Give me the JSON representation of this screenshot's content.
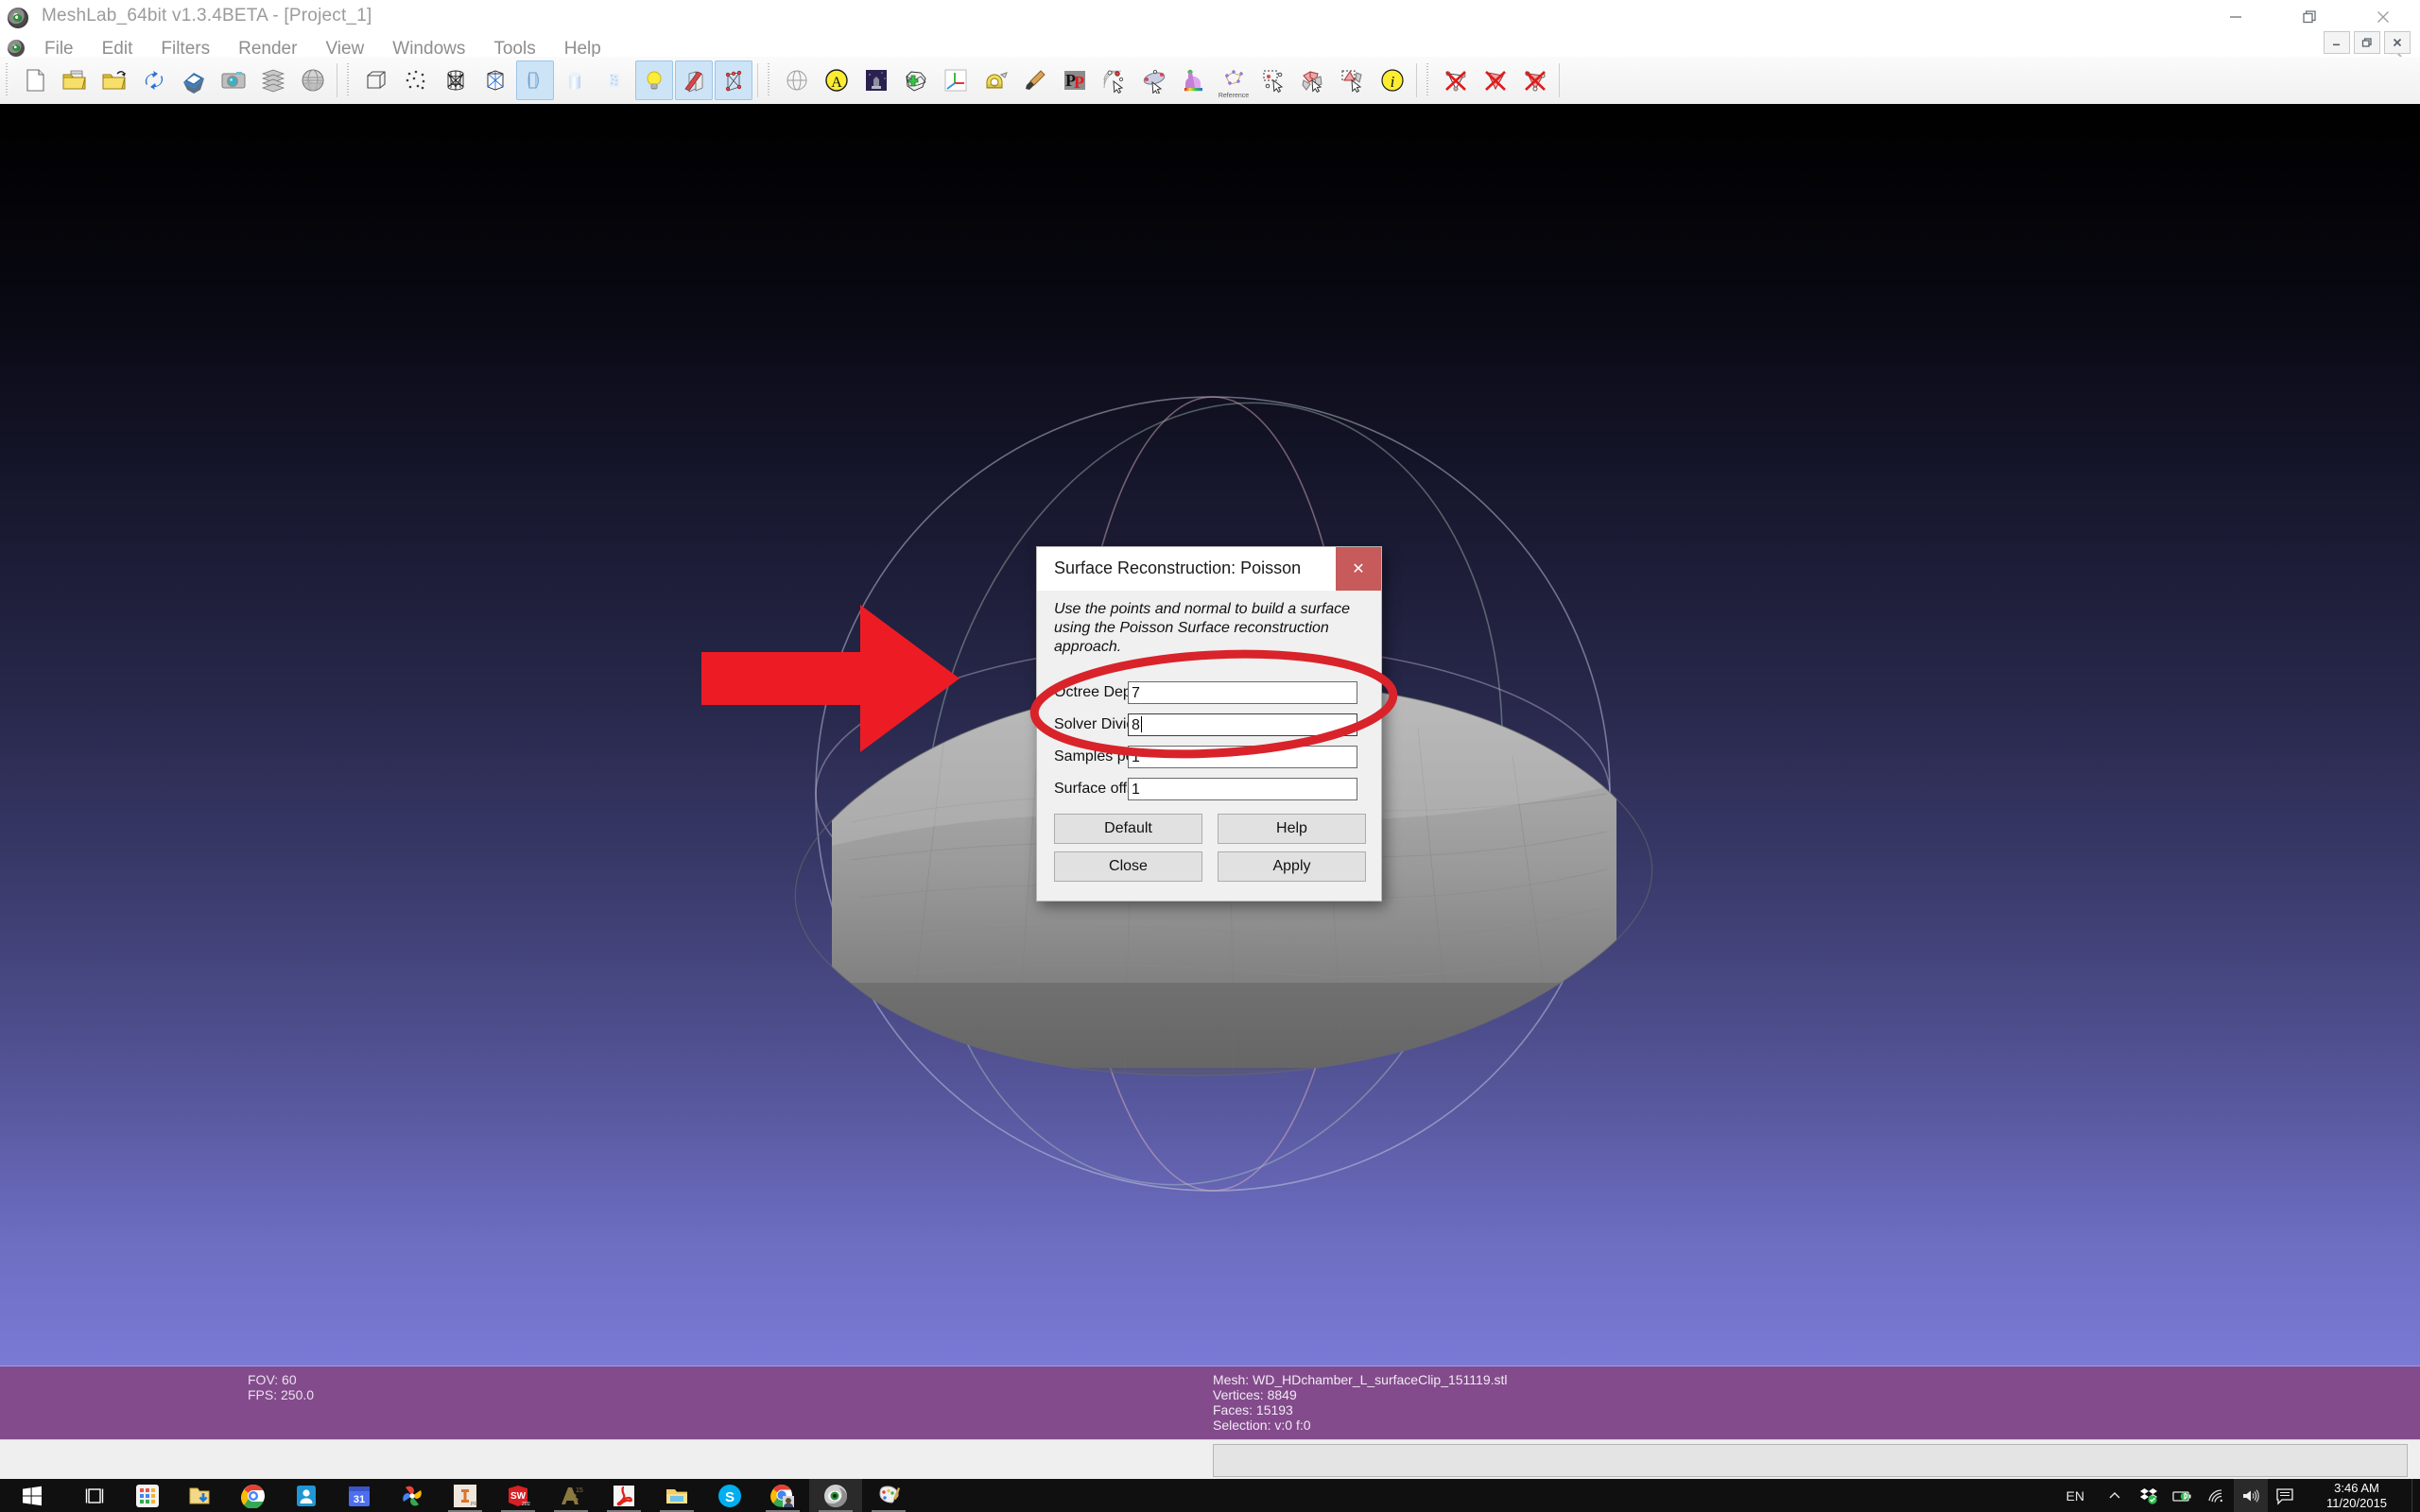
{
  "window": {
    "title": "MeshLab_64bit v1.3.4BETA - [Project_1]",
    "app_icon": "meshlab-eye-icon",
    "controls": [
      {
        "name": "minimize-button",
        "glyph": "minimize-icon"
      },
      {
        "name": "restore-button",
        "glyph": "restore-icon"
      },
      {
        "name": "close-button",
        "glyph": "close-icon"
      }
    ],
    "mdi_controls": [
      {
        "name": "mdi-minimize-button",
        "glyph": "minimize-icon"
      },
      {
        "name": "mdi-restore-button",
        "glyph": "restore-icon"
      },
      {
        "name": "mdi-close-button",
        "glyph": "close-icon"
      }
    ]
  },
  "menubar": {
    "items": [
      {
        "label": "File"
      },
      {
        "label": "Edit"
      },
      {
        "label": "Filters"
      },
      {
        "label": "Render"
      },
      {
        "label": "View"
      },
      {
        "label": "Windows"
      },
      {
        "label": "Tools"
      },
      {
        "label": "Help"
      }
    ],
    "search_icon": "search-icon"
  },
  "toolbar": {
    "groups": [
      {
        "buttons": [
          {
            "name": "new-project-button",
            "icon": "new-document-icon",
            "state": "off"
          },
          {
            "name": "open-project-button",
            "icon": "open-project-folder-icon",
            "state": "off"
          },
          {
            "name": "import-mesh-button",
            "icon": "open-folder-icon",
            "state": "off"
          },
          {
            "name": "reload-button",
            "icon": "reload-arrows-icon",
            "state": "off"
          },
          {
            "name": "save-snapshot-button",
            "icon": "save-layer-icon",
            "state": "off"
          },
          {
            "name": "take-snapshot-button",
            "icon": "camera-icon",
            "state": "off"
          },
          {
            "name": "show-layer-dialog-button",
            "icon": "layers-stack-icon",
            "state": "off"
          },
          {
            "name": "raster-layers-button",
            "icon": "globe-raster-icon",
            "state": "off"
          }
        ]
      },
      {
        "buttons": [
          {
            "name": "bounding-box-button",
            "icon": "wire-cube-icon",
            "state": "off"
          },
          {
            "name": "points-render-button",
            "icon": "point-cloud-icon",
            "state": "off"
          },
          {
            "name": "wireframe-render-button",
            "icon": "wireframe-icon",
            "state": "off"
          },
          {
            "name": "hidden-lines-render-button",
            "icon": "hidden-lines-icon",
            "state": "off"
          },
          {
            "name": "flat-lines-render-button",
            "icon": "flat-lines-icon",
            "state": "on"
          },
          {
            "name": "flat-render-button",
            "icon": "flat-shading-icon",
            "state": "off"
          },
          {
            "name": "smooth-render-button",
            "icon": "smooth-shading-icon",
            "state": "off"
          },
          {
            "name": "lighting-toggle-button",
            "icon": "lightbulb-icon",
            "state": "on"
          },
          {
            "name": "double-side-lighting-button",
            "icon": "double-side-light-icon",
            "state": "on"
          },
          {
            "name": "show-vertex-quality-button",
            "icon": "vertex-dots-icon",
            "state": "on"
          }
        ]
      },
      {
        "buttons": [
          {
            "name": "trackball-toggle-button",
            "icon": "trackball-sphere-icon",
            "state": "off"
          },
          {
            "name": "show-axis-button",
            "icon": "yellow-a-icon",
            "state": "off"
          },
          {
            "name": "shadow-mapping-button",
            "icon": "shadow-render-icon",
            "state": "off"
          },
          {
            "name": "select-faces-button",
            "icon": "green-mesh-icon",
            "state": "off"
          },
          {
            "name": "show-axes-button",
            "icon": "rgb-axes-icon",
            "state": "off"
          },
          {
            "name": "measuring-tool-button",
            "icon": "measuring-tape-icon",
            "state": "off"
          },
          {
            "name": "paint-tool-button",
            "icon": "paintbrush-icon",
            "state": "off"
          },
          {
            "name": "pickpoints-button",
            "icon": "pp-letters-icon",
            "state": "off"
          },
          {
            "name": "get-point-info-button",
            "icon": "pick-point-icon",
            "state": "off"
          },
          {
            "name": "edit-align-button",
            "icon": "align-points-icon",
            "state": "off"
          },
          {
            "name": "quality-mapper-button",
            "icon": "colored-bunny-icon",
            "state": "off"
          },
          {
            "name": "reference-button",
            "icon": "reference-graph-icon",
            "state": "off",
            "caption": "Reference"
          },
          {
            "name": "select-vertices-button",
            "icon": "rubber-band-select-icon",
            "state": "off"
          },
          {
            "name": "select-faces-click-button",
            "icon": "select-faces-icon",
            "state": "off"
          },
          {
            "name": "select-connected-button",
            "icon": "select-connected-icon",
            "state": "off"
          },
          {
            "name": "mesh-info-button",
            "icon": "info-icon",
            "state": "off"
          }
        ]
      },
      {
        "buttons": [
          {
            "name": "delete-vertices-button",
            "icon": "delete-vertices-icon",
            "state": "off"
          },
          {
            "name": "delete-faces-button",
            "icon": "delete-faces-icon",
            "state": "off"
          },
          {
            "name": "delete-faces-vertices-button",
            "icon": "delete-faces-vertices-icon",
            "state": "off"
          }
        ]
      }
    ]
  },
  "dialog": {
    "title": "Surface Reconstruction: Poisson",
    "close_label": "✕",
    "description": "Use the points and normal to build a surface using the Poisson Surface reconstruction approach.",
    "fields": [
      {
        "label": "Octree Depth",
        "value": "7",
        "focused": false
      },
      {
        "label": "Solver Divide",
        "value": "8",
        "focused": true
      },
      {
        "label": "Samples per Node",
        "value": "1",
        "focused": false
      },
      {
        "label": "Surface offsetting",
        "value": "1",
        "focused": false
      }
    ],
    "buttons": {
      "default": "Default",
      "help": "Help",
      "close": "Close",
      "apply": "Apply"
    }
  },
  "statusbar": {
    "left": [
      "FOV: 60",
      "FPS:  250.0"
    ],
    "mesh": [
      "Mesh: WD_HDchamber_L_surfaceClip_151119.stl",
      "Vertices: 8849",
      "Faces: 15193",
      "Selection: v:0 f:0"
    ]
  },
  "annotation": {
    "arrow": "red-arrow-annotation",
    "ellipse": "red-ellipse-annotation",
    "color": "#ED1C24",
    "ellipse_color": "#D9232A"
  },
  "taskbar": {
    "start": "windows-start-icon",
    "items": [
      {
        "name": "task-view-button",
        "icon": "task-view-icon",
        "state": "idle"
      },
      {
        "name": "app-launcher-button",
        "icon": "app-grid-icon",
        "state": "idle"
      },
      {
        "name": "downloads-folder-button",
        "icon": "folder-download-icon",
        "state": "idle"
      },
      {
        "name": "chrome-button",
        "icon": "chrome-icon",
        "state": "idle"
      },
      {
        "name": "contacts-button",
        "icon": "people-card-icon",
        "state": "idle"
      },
      {
        "name": "calendar-button",
        "icon": "calendar-31-icon",
        "state": "idle"
      },
      {
        "name": "google-photos-button",
        "icon": "pinwheel-icon",
        "state": "idle"
      },
      {
        "name": "inventor-button",
        "icon": "inventor-pro-icon",
        "state": "open"
      },
      {
        "name": "solidworks-button",
        "icon": "solidworks-2015-icon",
        "state": "open"
      },
      {
        "name": "autocad-button",
        "icon": "autocad-15-icon",
        "state": "open"
      },
      {
        "name": "acrobat-button",
        "icon": "acrobat-reader-icon",
        "state": "open"
      },
      {
        "name": "file-explorer-button",
        "icon": "file-explorer-icon",
        "state": "open"
      },
      {
        "name": "skype-button",
        "icon": "skype-icon",
        "state": "idle"
      },
      {
        "name": "chrome-profile-button",
        "icon": "chrome-profile-icon",
        "state": "open"
      },
      {
        "name": "meshlab-button",
        "icon": "meshlab-eye-icon",
        "state": "active"
      },
      {
        "name": "paint-button",
        "icon": "paint-palette-icon",
        "state": "open"
      }
    ],
    "tray": {
      "language": "EN",
      "icons": [
        {
          "name": "show-hidden-icons-button",
          "icon": "chevron-up-icon"
        },
        {
          "name": "dropbox-tray-icon",
          "icon": "dropbox-icon"
        },
        {
          "name": "battery-tray-icon",
          "icon": "battery-icon"
        },
        {
          "name": "network-tray-icon",
          "icon": "wifi-icon"
        },
        {
          "name": "volume-tray-icon",
          "icon": "speaker-icon"
        },
        {
          "name": "action-center-button",
          "icon": "notification-icon"
        }
      ],
      "time": "3:46 AM",
      "date": "11/20/2015"
    }
  }
}
